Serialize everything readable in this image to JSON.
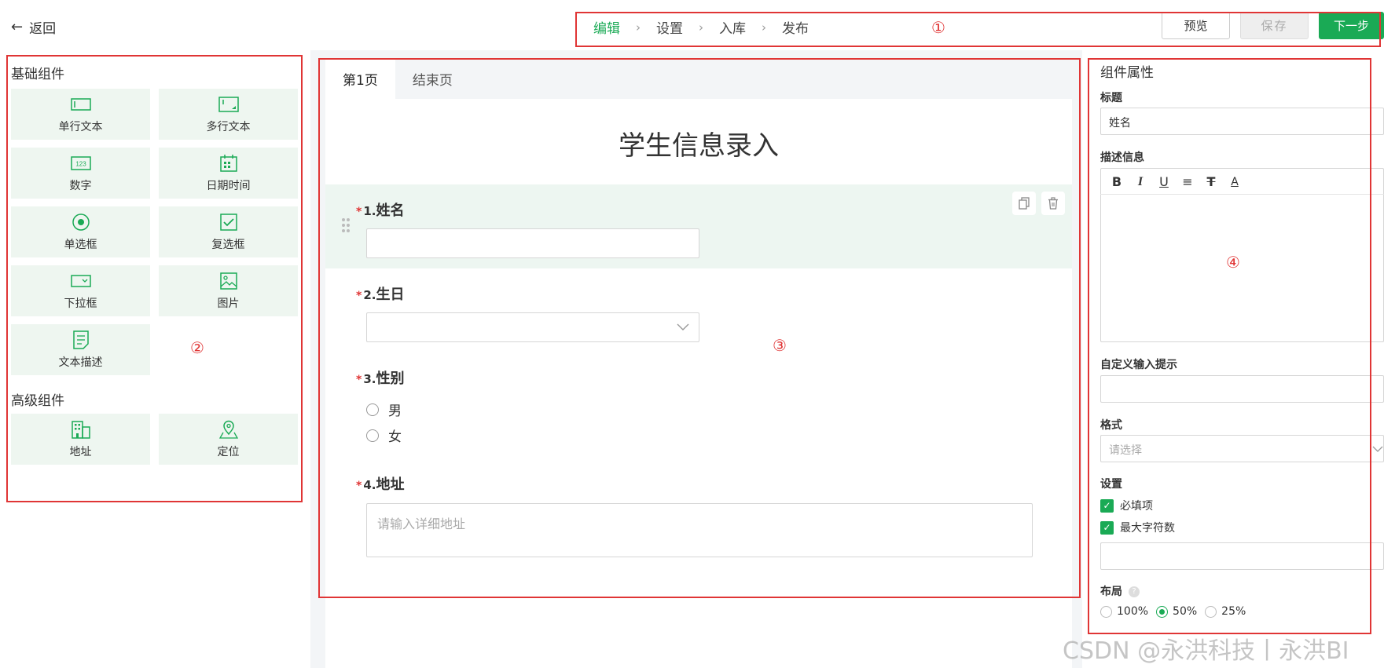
{
  "header": {
    "back_label": "返回",
    "steps": [
      "编辑",
      "设置",
      "入库",
      "发布"
    ],
    "preview_label": "预览",
    "save_label": "保存",
    "next_label": "下一步"
  },
  "annotations": [
    "①",
    "②",
    "③",
    "④"
  ],
  "left": {
    "basic_title": "基础组件",
    "basic": [
      {
        "label": "单行文本",
        "icon": "single-line-text-icon"
      },
      {
        "label": "多行文本",
        "icon": "multi-line-text-icon"
      },
      {
        "label": "数字",
        "icon": "number-icon"
      },
      {
        "label": "日期时间",
        "icon": "calendar-icon"
      },
      {
        "label": "单选框",
        "icon": "radio-icon"
      },
      {
        "label": "复选框",
        "icon": "checkbox-icon"
      },
      {
        "label": "下拉框",
        "icon": "dropdown-icon"
      },
      {
        "label": "图片",
        "icon": "image-icon"
      },
      {
        "label": "文本描述",
        "icon": "text-description-icon"
      }
    ],
    "advanced_title": "高级组件",
    "advanced": [
      {
        "label": "地址",
        "icon": "address-building-icon"
      },
      {
        "label": "定位",
        "icon": "location-pin-icon"
      }
    ]
  },
  "center": {
    "tabs": [
      "第1页",
      "结束页"
    ],
    "form_title": "学生信息录入",
    "questions": [
      {
        "num": "1.",
        "label": "姓名"
      },
      {
        "num": "2.",
        "label": "生日"
      },
      {
        "num": "3.",
        "label": "性别",
        "options": [
          "男",
          "女"
        ]
      },
      {
        "num": "4.",
        "label": "地址",
        "placeholder": "请输入详细地址"
      }
    ]
  },
  "right": {
    "title": "组件属性",
    "label_title": "标题",
    "title_value": "姓名",
    "label_desc": "描述信息",
    "toolbar": [
      "B",
      "I",
      "U",
      "≡",
      "T",
      "A"
    ],
    "label_hint": "自定义输入提示",
    "label_format": "格式",
    "format_placeholder": "请选择",
    "label_settings": "设置",
    "required_label": "必填项",
    "maxchars_label": "最大字符数",
    "label_layout": "布局",
    "layout_options": [
      "100%",
      "50%",
      "25%"
    ],
    "layout_selected": "50%"
  },
  "watermark": "CSDN @永洪科技丨永洪BI",
  "colors": {
    "accent": "#1aaa55",
    "annotation_red": "#e03535"
  }
}
